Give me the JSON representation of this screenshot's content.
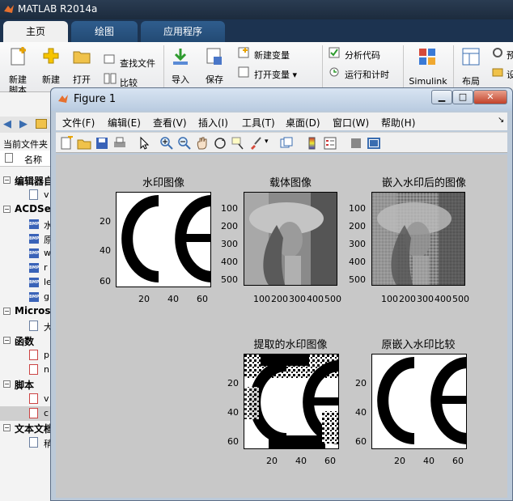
{
  "matlab": {
    "title": "MATLAB R2014a",
    "tabs": [
      "主页",
      "绘图",
      "应用程序"
    ],
    "ribbon": {
      "new_script": "新建\n脚本",
      "new": "新建",
      "open": "打开",
      "find_files": "查找文件",
      "compare": "比较",
      "import": "导入",
      "save": "保存",
      "new_variable": "新建变量",
      "open_variable": "打开变量",
      "analyze_code": "分析代码",
      "run_and_time": "运行和计时",
      "simulink": "Simulink",
      "layout": "布局",
      "right_cut_1": "预",
      "right_cut_2": "设"
    },
    "current_folder_label": "当前文件夹",
    "name_col": "名称",
    "tree": [
      {
        "kind": "group",
        "label": "编辑器自"
      },
      {
        "kind": "file",
        "label": "v"
      },
      {
        "kind": "group",
        "label": "ACDSee"
      },
      {
        "kind": "bmp",
        "label": "水"
      },
      {
        "kind": "bmp",
        "label": "原"
      },
      {
        "kind": "bmp",
        "label": "w"
      },
      {
        "kind": "bmp",
        "label": "r"
      },
      {
        "kind": "bmp",
        "label": "le"
      },
      {
        "kind": "bmp",
        "label": "g"
      },
      {
        "kind": "group",
        "label": "Microsc"
      },
      {
        "kind": "file",
        "label": "大"
      },
      {
        "kind": "group",
        "label": "函数"
      },
      {
        "kind": "func",
        "label": "p"
      },
      {
        "kind": "func",
        "label": "n"
      },
      {
        "kind": "group",
        "label": "脚本"
      },
      {
        "kind": "script",
        "label": "v"
      },
      {
        "kind": "script",
        "label": "c"
      },
      {
        "kind": "group",
        "label": "文本文档"
      },
      {
        "kind": "file",
        "label": "稍"
      }
    ]
  },
  "figure": {
    "title": "Figure 1",
    "menus": [
      "文件(F)",
      "编辑(E)",
      "查看(V)",
      "插入(I)",
      "工具(T)",
      "桌面(D)",
      "窗口(W)",
      "帮助(H)"
    ],
    "plots": [
      {
        "title": "水印图像",
        "yticks": [
          "20",
          "40",
          "60"
        ],
        "xticks": [
          "20",
          "40",
          "60"
        ]
      },
      {
        "title": "载体图像",
        "yticks": [
          "100",
          "200",
          "300",
          "400",
          "500"
        ],
        "xticks": [
          "100",
          "200",
          "300",
          "400",
          "500"
        ]
      },
      {
        "title": "嵌入水印后的图像",
        "yticks": [
          "100",
          "200",
          "300",
          "400",
          "500"
        ],
        "xticks": [
          "100",
          "200",
          "300",
          "400",
          "500"
        ]
      },
      {
        "title": "提取的水印图像",
        "yticks": [
          "20",
          "40",
          "60"
        ],
        "xticks": [
          "20",
          "40",
          "60"
        ]
      },
      {
        "title": "原嵌入水印比较",
        "yticks": [
          "20",
          "40",
          "60"
        ],
        "xticks": [
          "20",
          "40",
          "60"
        ]
      }
    ]
  },
  "colors": {
    "accent": "#2f5d8d",
    "figure_bg": "#c8c8c8"
  }
}
